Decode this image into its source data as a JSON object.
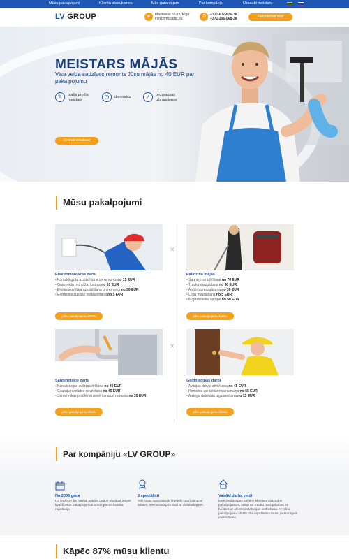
{
  "topnav": {
    "items": [
      "Mūsu pakalpojumi",
      "Klientu atsauksmes",
      "Mēs garantējam",
      "Par kompāniju",
      "Uzsaukt meistaru"
    ]
  },
  "header": {
    "logo_lv": "LV",
    "logo_group": "GROUP",
    "address_line1": "Maskavas 322D, Rīga",
    "address_line2": "info@lmsbaltic.eu",
    "phone_line1": "+371-672-626-36",
    "phone_line2": "+371-296-068-38",
    "cta_label": "Pieruniemet man"
  },
  "hero": {
    "title": "MEISTARS MĀJĀS",
    "subtitle": "Visa veida sadzīves remonts Jūsu mājās no 40 EUR par pakalpojumu",
    "features": [
      {
        "line1": "plaša profila",
        "line2": "meistars"
      },
      {
        "line1": "diennakts",
        "line2": ""
      },
      {
        "line1": "bezmaksas",
        "line2": "izbraucienss"
      }
    ],
    "button_label": "Uzzināt izmaksas"
  },
  "services": {
    "title": "Mūsu pakalpojumi",
    "items": [
      {
        "name": "Elektromontāžas darbi",
        "lines": [
          {
            "text": "Kontaktligzdu uzstādīšana un remonts",
            "price": "no 15 EUR"
          },
          {
            "text": "Gaismekļu montāža, lustras",
            "price": "no 20 EUR"
          },
          {
            "text": "Elektroskaitītāja uzstādīšana un remonts",
            "price": "no 50 EUR"
          },
          {
            "text": "Elektroinstalācijas restaurēšana",
            "price": "no 5 EUR"
          }
        ],
        "button": "pilnu pakalpojumu klāstu"
      },
      {
        "name": "Palīdzība mājās",
        "lines": [
          {
            "text": "Saunā, mitrā tīrīšana",
            "price": "no 70 EUR"
          },
          {
            "text": "Trauku mazgāšana",
            "price": "no 30 EUR"
          },
          {
            "text": "Apģērba mazgāšana",
            "price": "no 30 EUR"
          },
          {
            "text": "Logu mazgāšana",
            "price": "no 5 EUR"
          },
          {
            "text": "Majdzīvnieku aprūpe",
            "price": "no 50 EUR"
          }
        ],
        "button": "pilnu pakalpojumu klāstu"
      },
      {
        "name": "Santehniskie darbi",
        "lines": [
          {
            "text": "Kanalizācijas avārijas tīrīšana",
            "price": "no 40 EUR"
          },
          {
            "text": "Cauruļu noplūdes novēršana",
            "price": "no 40 EUR"
          },
          {
            "text": "Santehnikas problēmu novēršana un remonts",
            "price": "no 35 EUR"
          }
        ],
        "button": "pilnu pakalpojumu klāstu"
      },
      {
        "name": "Galdniecības darbi",
        "lines": [
          {
            "text": "Avārijas durvju atvēršana",
            "price": "no 45 EUR"
          },
          {
            "text": "Remonts vai slēdzenes nomaiņa",
            "price": "no 55 EUR"
          },
          {
            "text": "Atslēgu dublikātu izgatavošana",
            "price": "no 15 EUR"
          }
        ],
        "button": "pilnu pakalpojumu klāstu"
      }
    ]
  },
  "about": {
    "title": "Par kompāniju «LV GROUP»",
    "columns": [
      {
        "icon": "calendar-icon",
        "head": "No 2008 gada",
        "text": "LV GROUP jau vairāk nekā 8 gadus piedāvā augsti kvalificētus pakalpojumus un tai piemīt lieliska reputācija."
      },
      {
        "icon": "badge-icon",
        "head": "9 speciālisti",
        "text": "Visi mūsu speciālisti ir izgājuši cauri stingrai atlasei, mēs strādājam tikai ar vislabākajiem."
      },
      {
        "icon": "house-icon",
        "head": "Vairāki darba veidi",
        "text": "Mēs piedāvājam saviem klientiem dažādus pakalpojumus, sākot no trauku mazgāšanas un beidzot ar elektroinstalācijas ierīkošanu. Ar pilnu pakalpojumu klāstu Jūs iepazīsties mūsu personīgais menedžeris."
      }
    ]
  },
  "why": {
    "title": "Kāpēc 87% mūsu klientu"
  },
  "colors": {
    "brand_blue": "#1e56b3",
    "accent_orange": "#f3a11c",
    "heading_blue": "#1a3e7a"
  }
}
